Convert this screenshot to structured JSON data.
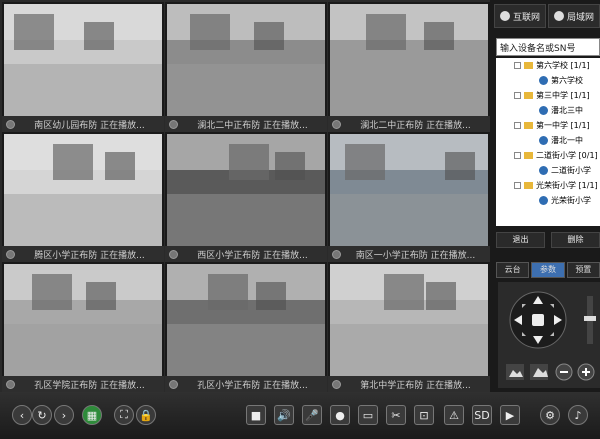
{
  "cameras": [
    {
      "caption": "南区幼儿园布防 正在播放..."
    },
    {
      "caption": "澜北二中正布防 正在播放..."
    },
    {
      "caption": "澜北二中正布防 正在播放..."
    },
    {
      "caption": "腾区小学正布防 正在播放..."
    },
    {
      "caption": "西区小学正布防 正在播放..."
    },
    {
      "caption": "南区一小学正布防 正在播放..."
    },
    {
      "caption": "孔区学院正布防 正在播放..."
    },
    {
      "caption": "孔区小学正布防 正在播放..."
    },
    {
      "caption": "第北中学正布防 正在播放..."
    }
  ],
  "panel": {
    "tab_internet": "互联网",
    "tab_lan": "局域网",
    "search_placeholder": "输入设备名或SN号",
    "tree": [
      {
        "label": "第六学校 [1/1]",
        "child": "第六学校"
      },
      {
        "label": "第三中学 [1/1]",
        "child": "潘北三中"
      },
      {
        "label": "第一中学 [1/1]",
        "child": "潘北一中"
      },
      {
        "label": "二道街小学 [0/1]",
        "child": "二道街小学"
      },
      {
        "label": "光荣街小学 [1/1]",
        "child": "光荣街小学"
      }
    ],
    "btn_exit": "退出",
    "btn_delete": "删除",
    "ctrl_tabs": [
      "云台",
      "参数",
      "预置"
    ],
    "active_ctrl_tab": 1
  },
  "toolbar": {
    "icons": [
      "back-icon",
      "refresh-icon",
      "forward-icon",
      "grid-layout-icon",
      "fullscreen-icon",
      "lock-icon",
      "stop-icon",
      "volume-icon",
      "microphone-icon",
      "record-icon",
      "monitor-icon",
      "capture-icon",
      "screenshot-icon",
      "alarm-icon",
      "sd-card-icon",
      "playback-icon",
      "settings-icon",
      "talk-icon"
    ]
  }
}
